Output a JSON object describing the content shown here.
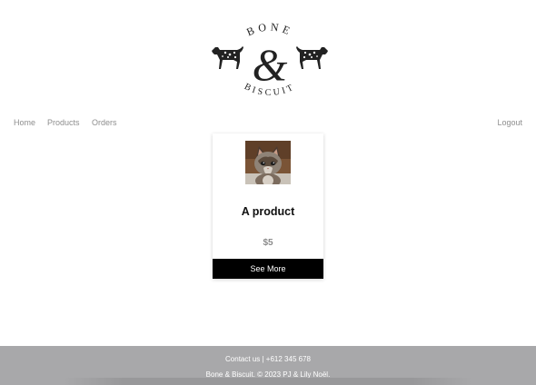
{
  "brand": {
    "logo_top_text": "BONE",
    "logo_ampersand": "&",
    "logo_bottom_text": "BISCUIT",
    "logo_icon_left": "dalmatian-dog-icon",
    "logo_icon_right": "dalmatian-dog-icon"
  },
  "nav": {
    "home_label": "Home",
    "products_label": "Products",
    "orders_label": "Orders",
    "logout_label": "Logout"
  },
  "products": [
    {
      "image_icon": "kitten-photo",
      "name": "A product",
      "price": "$5",
      "button_label": "See More"
    }
  ],
  "footer": {
    "contact": "Contact us | +612 345 678",
    "copyright": "Bone & Biscuit. © 2023 PJ & Lily Noël."
  },
  "colors": {
    "nav_text": "#8e8e8e",
    "button_bg": "#000000",
    "button_text": "#ffffff",
    "price_text": "#8a8a8a",
    "footer_bg": "#a8a8aa",
    "footer_text": "#ffffff"
  }
}
